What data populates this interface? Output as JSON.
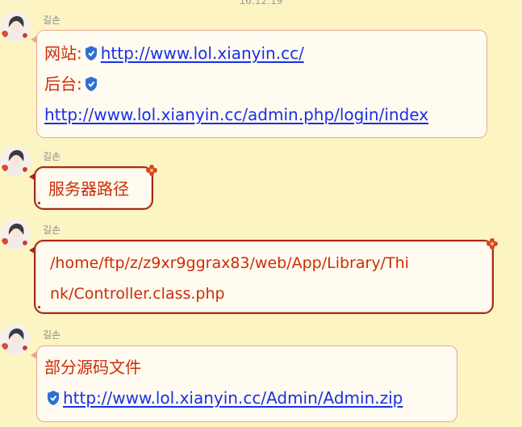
{
  "chat": {
    "timestamp": "16:12:19",
    "messages": [
      {
        "sender": "길손",
        "line1_label": "网站:",
        "line1_link": "http://www.lol.xianyin.cc/",
        "line2_label": "后台:",
        "line3_link": "http://www.lol.xianyin.cc/admin.php/login/index"
      },
      {
        "sender": "길손",
        "text": "服务器路径"
      },
      {
        "sender": "길손",
        "line1": "/home/ftp/z/z9xr9ggrax83/web/App/Library/Thi",
        "line2": "nk/Controller.class.php"
      },
      {
        "sender": "길손",
        "line1": "部分源码文件",
        "link": "http://www.lol.xianyin.cc/Admin/Admin.zip"
      }
    ]
  },
  "colors": {
    "background": "#fdf4c4",
    "bubble": "#fffbf0",
    "text": "#cc2c06",
    "link": "#1a2fe8",
    "shield": "#2f6fd6"
  },
  "icons": [
    "avatar-icon",
    "shield-icon",
    "flower-icon"
  ]
}
